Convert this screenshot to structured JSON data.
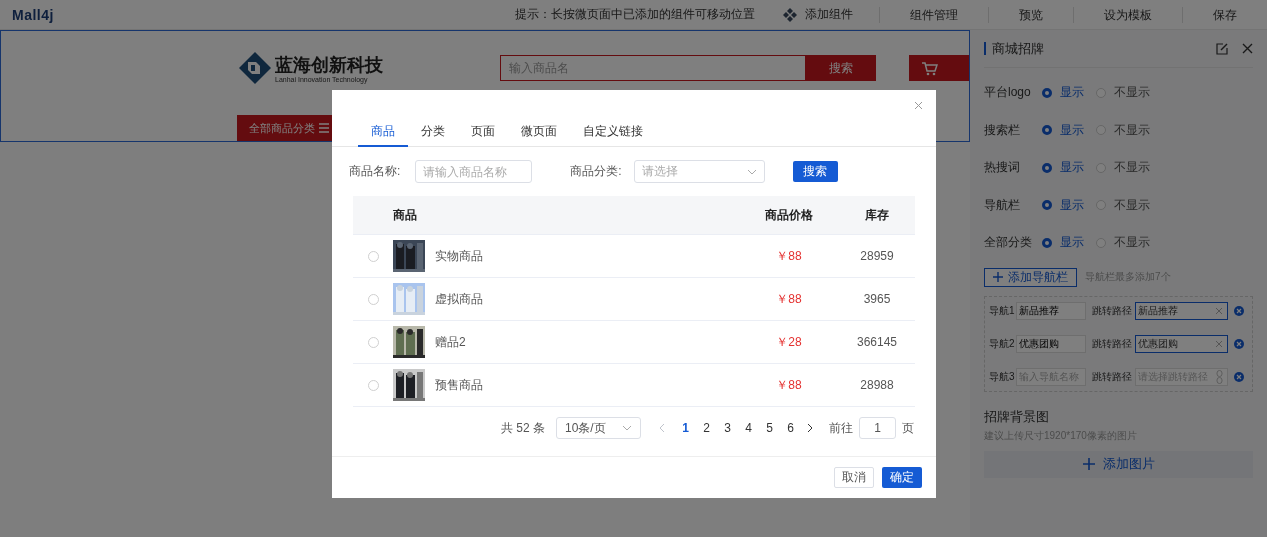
{
  "topbar": {
    "logo": "Mall4j",
    "hint": "提示：长按微页面中已添加的组件可移动位置",
    "add_component": "添加组件",
    "actions": [
      "组件管理",
      "预览",
      "设为模板",
      "保存"
    ]
  },
  "preview": {
    "brand_name": "蓝海创新科技",
    "brand_sub": "Lanhai Innovation Technology",
    "search_placeholder": "输入商品名",
    "search_button": "搜索",
    "category_button": "全部商品分类"
  },
  "panel": {
    "title": "商城招牌",
    "toggles": [
      {
        "label": "平台logo",
        "options": [
          {
            "label": "显示",
            "selected": true
          },
          {
            "label": "不显示",
            "selected": false
          }
        ]
      },
      {
        "label": "搜索栏",
        "options": [
          {
            "label": "显示",
            "selected": true
          },
          {
            "label": "不显示",
            "selected": false
          }
        ]
      },
      {
        "label": "热搜词",
        "options": [
          {
            "label": "显示",
            "selected": true
          },
          {
            "label": "不显示",
            "selected": false
          }
        ]
      },
      {
        "label": "导航栏",
        "options": [
          {
            "label": "显示",
            "selected": true
          },
          {
            "label": "不显示",
            "selected": false
          }
        ]
      },
      {
        "label": "全部分类",
        "options": [
          {
            "label": "显示",
            "selected": true
          },
          {
            "label": "不显示",
            "selected": false
          }
        ]
      }
    ],
    "add_nav_button": "添加导航栏",
    "add_nav_hint": "导航栏最多添加7个",
    "navs": [
      {
        "label": "导航1",
        "name_value": "新品推荐",
        "path_label": "跳转路径",
        "path_value": "新品推荐",
        "path_focused": true
      },
      {
        "label": "导航2",
        "name_value": "优惠团购",
        "path_label": "跳转路径",
        "path_value": "优惠团购",
        "path_focused": true
      },
      {
        "label": "导航3",
        "name_placeholder": "输入导航名称",
        "path_label": "跳转路径",
        "path_placeholder": "请选择跳转路径",
        "path_focused": false
      }
    ],
    "bg_title": "招牌背景图",
    "bg_hint": "建议上传尺寸1920*170像素的图片",
    "add_image": "添加图片"
  },
  "dialog": {
    "tabs": [
      {
        "label": "商品",
        "selected": true
      },
      {
        "label": "分类",
        "selected": false
      },
      {
        "label": "页面",
        "selected": false
      },
      {
        "label": "微页面",
        "selected": false
      },
      {
        "label": "自定义链接",
        "selected": false
      }
    ],
    "name_label": "商品名称:",
    "name_placeholder": "请输入商品名称",
    "category_label": "商品分类:",
    "category_placeholder": "请选择",
    "search_button": "搜索",
    "columns": [
      "商品",
      "商品价格",
      "库存"
    ],
    "rows": [
      {
        "selected": false,
        "name": "实物商品",
        "price": "￥88",
        "stock": "28959"
      },
      {
        "selected": false,
        "name": "虚拟商品",
        "price": "￥88",
        "stock": "3965"
      },
      {
        "selected": false,
        "name": "赠品2",
        "price": "￥28",
        "stock": "366145"
      },
      {
        "selected": false,
        "name": "预售商品",
        "price": "￥88",
        "stock": "28988"
      }
    ],
    "pagination": {
      "total": "共 52 条",
      "page_size": "10条/页",
      "pages": [
        {
          "label": "1",
          "selected": true
        },
        {
          "label": "2",
          "selected": false
        },
        {
          "label": "3",
          "selected": false
        },
        {
          "label": "4",
          "selected": false
        },
        {
          "label": "5",
          "selected": false
        },
        {
          "label": "6",
          "selected": false
        }
      ],
      "goto_label": "前往",
      "goto_value": "1",
      "goto_unit": "页"
    },
    "cancel": "取消",
    "confirm": "确定"
  }
}
